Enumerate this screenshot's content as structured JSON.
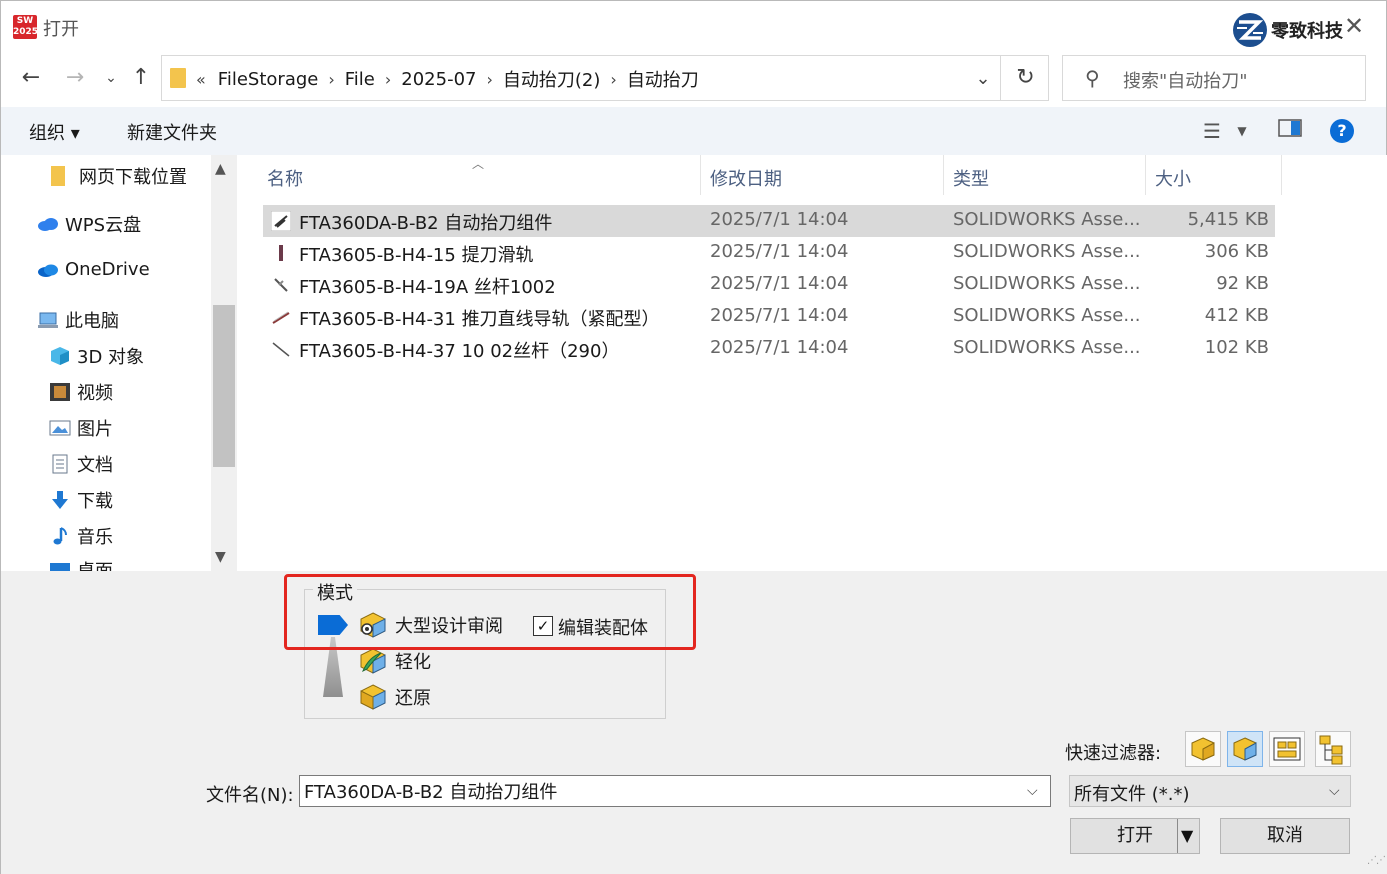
{
  "window": {
    "title": "打开",
    "app_icon_text": "SW\n2025",
    "brand": "零致科技"
  },
  "address": {
    "chevrons": "«",
    "crumbs": [
      "FileStorage",
      "File",
      "2025-07",
      "自动抬刀(2)",
      "自动抬刀"
    ]
  },
  "search": {
    "placeholder": "搜索\"自动抬刀\""
  },
  "toolbar": {
    "organize": "组织 ▾",
    "new_folder": "新建文件夹"
  },
  "sidebar": {
    "items": [
      {
        "label": "网页下载位置",
        "icon": "folder-icon"
      },
      {
        "label": "WPS云盘",
        "icon": "cloud-icon"
      },
      {
        "label": "OneDrive",
        "icon": "onedrive-icon"
      },
      {
        "label": "此电脑",
        "icon": "computer-icon"
      },
      {
        "label": "3D 对象",
        "icon": "cube-icon"
      },
      {
        "label": "视频",
        "icon": "video-icon"
      },
      {
        "label": "图片",
        "icon": "picture-icon"
      },
      {
        "label": "文档",
        "icon": "document-icon"
      },
      {
        "label": "下载",
        "icon": "download-icon"
      },
      {
        "label": "音乐",
        "icon": "music-icon"
      },
      {
        "label": "桌面",
        "icon": "desktop-icon"
      }
    ]
  },
  "table": {
    "headers": [
      "名称",
      "修改日期",
      "类型",
      "大小"
    ],
    "rows": [
      {
        "name": "FTA360DA-B-B2 自动抬刀组件",
        "date": "2025/7/1 14:04",
        "type": "SOLIDWORKS Asse...",
        "size": "5,415 KB",
        "selected": true
      },
      {
        "name": "FTA3605-B-H4-15 提刀滑轨",
        "date": "2025/7/1 14:04",
        "type": "SOLIDWORKS Asse...",
        "size": "306 KB",
        "selected": false
      },
      {
        "name": "FTA3605-B-H4-19A 丝杆1002",
        "date": "2025/7/1 14:04",
        "type": "SOLIDWORKS Asse...",
        "size": "92 KB",
        "selected": false
      },
      {
        "name": "FTA3605-B-H4-31 推刀直线导轨（紧配型）",
        "date": "2025/7/1 14:04",
        "type": "SOLIDWORKS Asse...",
        "size": "412 KB",
        "selected": false
      },
      {
        "name": "FTA3605-B-H4-37 10 02丝杆（290）",
        "date": "2025/7/1 14:04",
        "type": "SOLIDWORKS Asse...",
        "size": "102 KB",
        "selected": false
      }
    ]
  },
  "mode": {
    "label": "模式",
    "options": [
      "大型设计审阅",
      "轻化",
      "还原"
    ],
    "edit_assembly_label": "编辑装配体",
    "edit_assembly_checked": true,
    "checkmark": "✓"
  },
  "quick_filter": {
    "label": "快速过滤器:"
  },
  "filename": {
    "label": "文件名(N):",
    "value": "FTA360DA-B-B2 自动抬刀组件"
  },
  "filetype": {
    "value": "所有文件 (*.*)"
  },
  "buttons": {
    "open": "打开",
    "cancel": "取消"
  },
  "colors": {
    "accent": "#0a6cd6",
    "highlight_box": "#e3261f",
    "selected_row": "#d9d9d9"
  }
}
